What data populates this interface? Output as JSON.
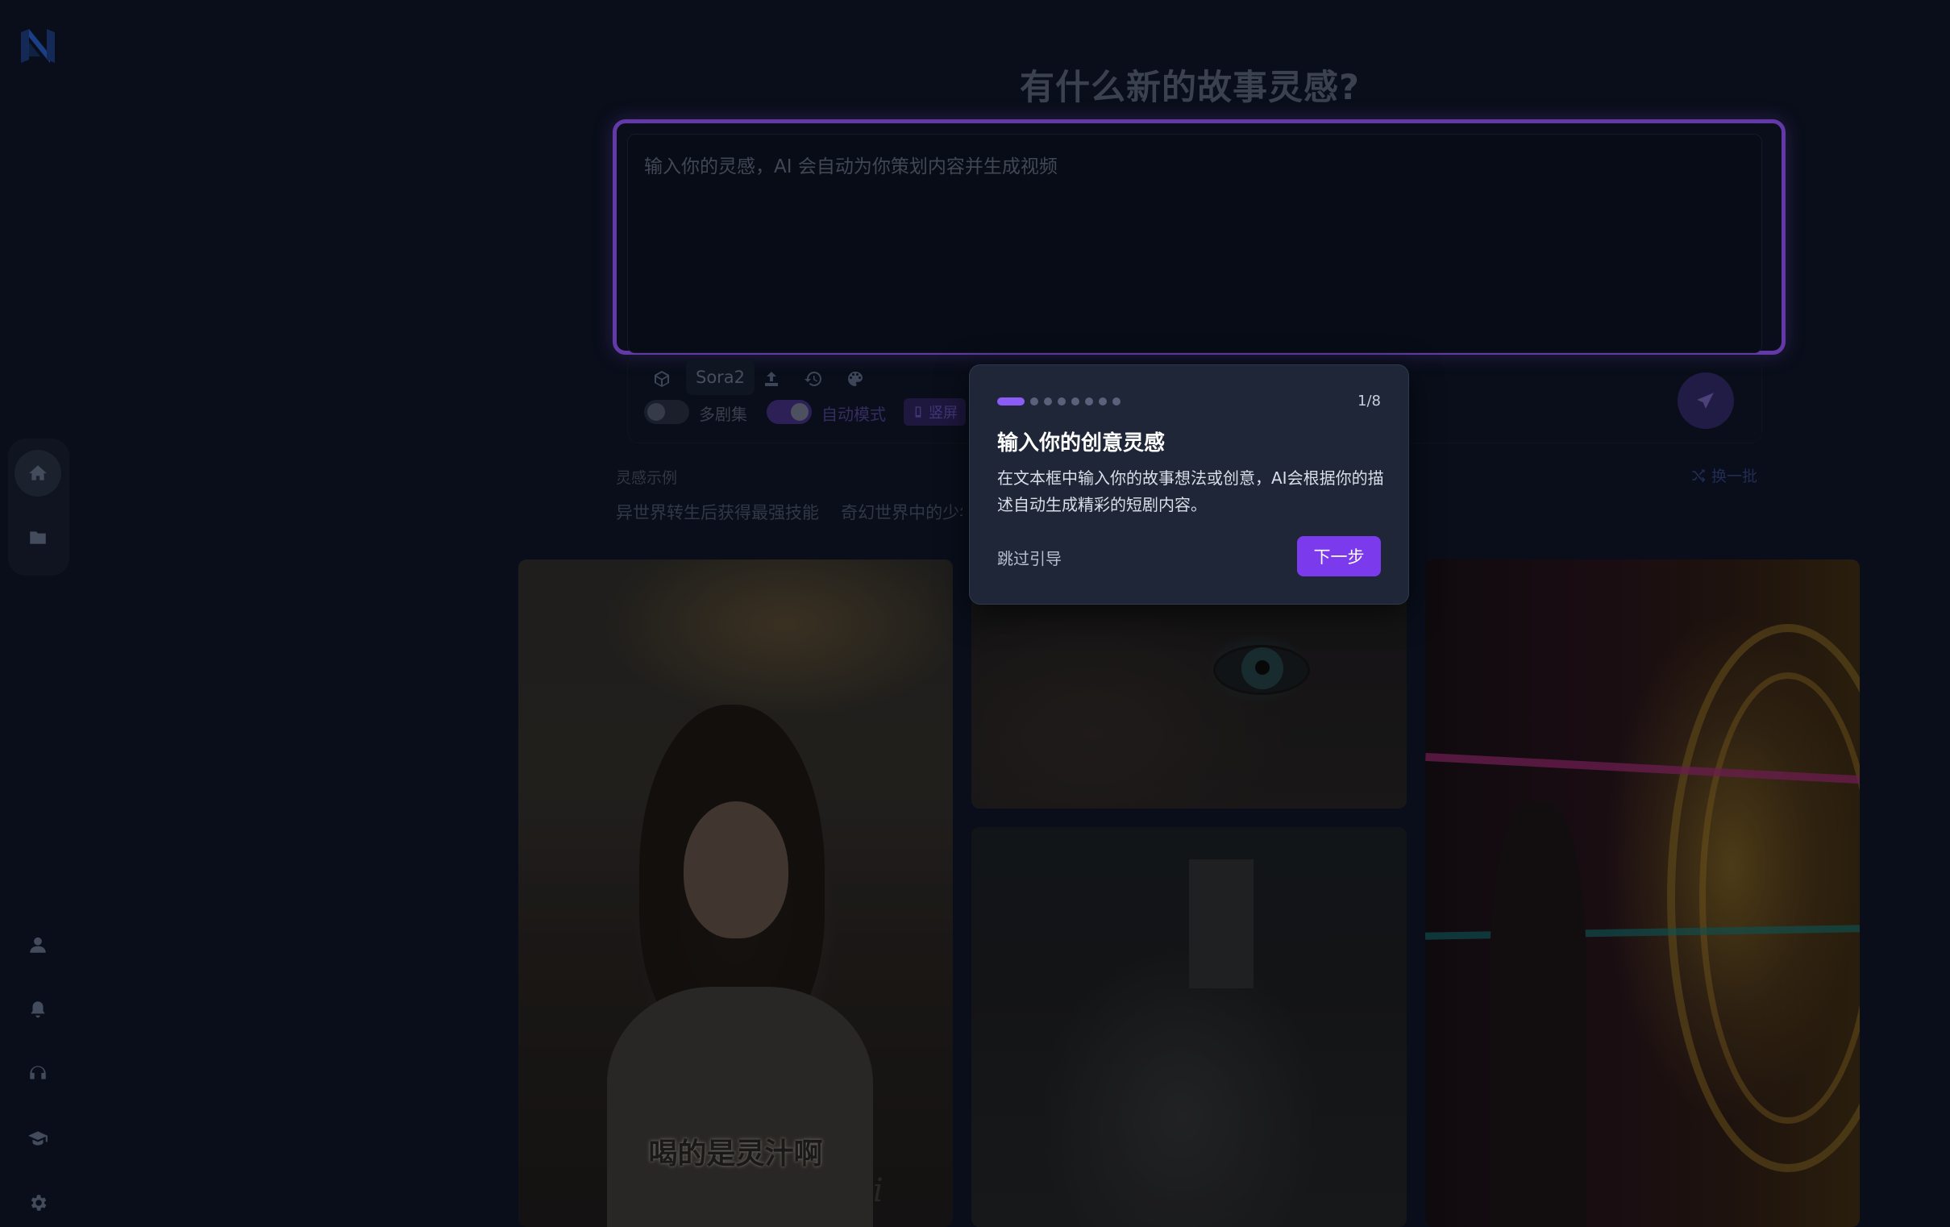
{
  "page": {
    "title": "有什么新的故事灵感?"
  },
  "prompt": {
    "placeholder": "输入你的灵感，AI 会自动为你策划内容并生成视频"
  },
  "toolbar": {
    "model_label": "Sora2",
    "multi_episode_label": "多剧集",
    "auto_mode_label": "自动模式",
    "orientation_label": "竖屏"
  },
  "inspiration": {
    "label": "灵感示例",
    "refresh_label": "换一批",
    "examples": [
      "异世界转生后获得最强技能",
      "奇幻世界中的少年与"
    ]
  },
  "gallery": {
    "card1_caption": "喝的是灵汁啊",
    "card1_signature": "Awuli"
  },
  "guide": {
    "step": "1/8",
    "total_steps": 8,
    "current_step": 1,
    "title": "输入你的创意灵感",
    "description": "在文本框中输入你的故事想法或创意，AI会根据你的描述自动生成精彩的短剧内容。",
    "skip_label": "跳过引导",
    "next_label": "下一步"
  },
  "colors": {
    "accent": "#8a4fe8",
    "button": "#7c3aed",
    "background": "#0d1424",
    "tooltip": "#1e2637"
  },
  "icons": {
    "sidebar": [
      "home-icon",
      "folder-icon"
    ],
    "sidebar_bottom": [
      "user-icon",
      "bell-icon",
      "headset-icon",
      "graduation-cap-icon",
      "gear-icon"
    ],
    "toolbar": [
      "cube-icon",
      "upload-icon",
      "history-icon",
      "palette-icon",
      "send-icon"
    ]
  }
}
